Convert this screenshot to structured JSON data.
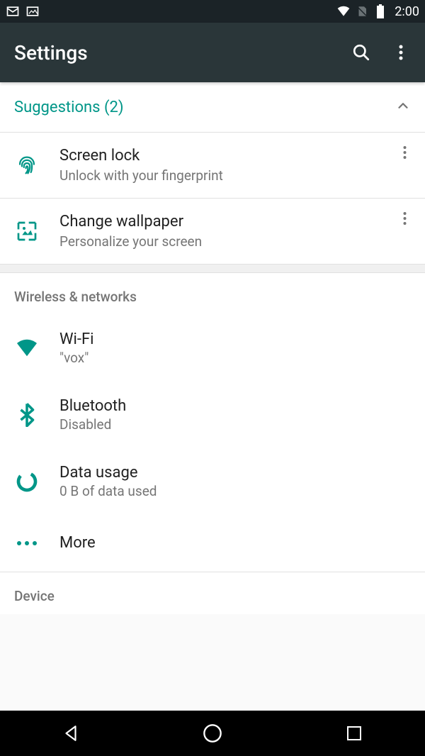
{
  "status": {
    "time": "2:00"
  },
  "appbar": {
    "title": "Settings"
  },
  "suggestions": {
    "header": "Suggestions (2)",
    "items": [
      {
        "title": "Screen lock",
        "subtitle": "Unlock with your fingerprint"
      },
      {
        "title": "Change wallpaper",
        "subtitle": "Personalize your screen"
      }
    ]
  },
  "sections": {
    "wireless": {
      "header": "Wireless & networks",
      "items": [
        {
          "title": "Wi-Fi",
          "subtitle": "\"vox\""
        },
        {
          "title": "Bluetooth",
          "subtitle": "Disabled"
        },
        {
          "title": "Data usage",
          "subtitle": "0 B of data used"
        },
        {
          "title": "More",
          "subtitle": ""
        }
      ]
    },
    "device": {
      "header": "Device"
    }
  },
  "colors": {
    "teal": "#009688",
    "grey": "#757575"
  }
}
